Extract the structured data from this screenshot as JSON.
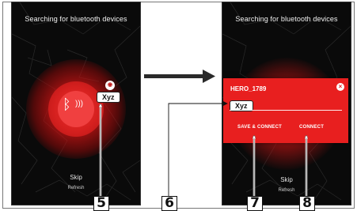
{
  "left_screen": {
    "title": "Searching for bluetooth devices",
    "device_label": "Xyz",
    "skip_label": "Skip",
    "refresh_label": "Refresh"
  },
  "right_screen": {
    "title": "Searching for bluetooth devices",
    "dialog": {
      "device_name": "HERO_1789",
      "input_value": "Xyz",
      "save_connect_label": "SAVE & CONNECT",
      "connect_label": "CONNECT",
      "close_icon": "close-icon"
    },
    "skip_label": "Skip",
    "refresh_label": "Refresh"
  },
  "annotations": {
    "n5": "5",
    "n6": "6",
    "n7": "7",
    "n8": "8"
  },
  "colors": {
    "accent_red": "#e81f1f",
    "screen_bg": "#0a0a0a",
    "text_white": "#ffffff"
  },
  "icons": {
    "bluetooth": "bluetooth-icon",
    "signal": "signal-waves-icon",
    "arrow": "right-arrow-icon"
  }
}
